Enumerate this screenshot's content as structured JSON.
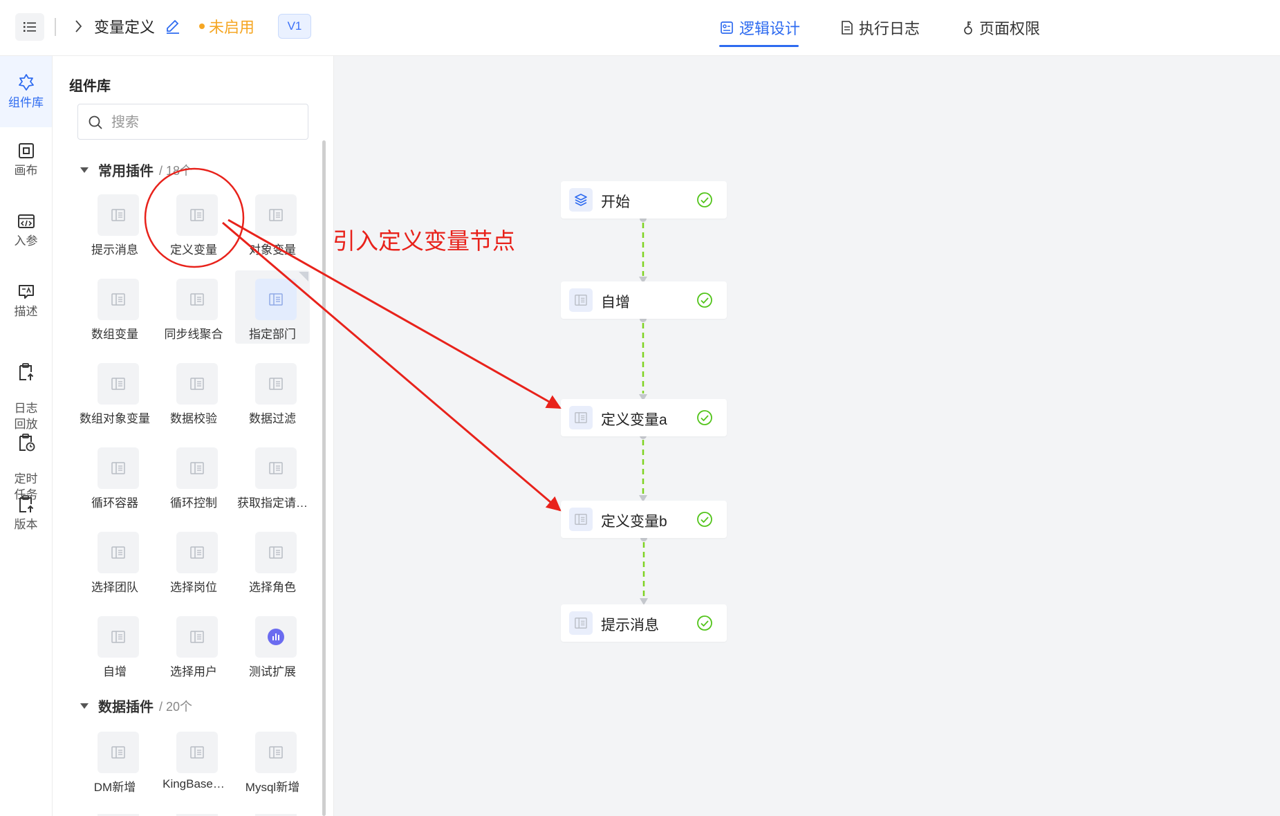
{
  "header": {
    "title": "变量定义",
    "status": "未启用",
    "version": "V1",
    "tabs": [
      {
        "label": "逻辑设计",
        "active": true
      },
      {
        "label": "执行日志",
        "active": false
      },
      {
        "label": "页面权限",
        "active": false
      }
    ]
  },
  "rail": {
    "items": [
      {
        "label": "组件库",
        "icon": "puzzle-icon",
        "active": true
      },
      {
        "label": "画布",
        "icon": "canvas-icon"
      },
      {
        "label": "入参",
        "icon": "code-icon"
      },
      {
        "label": "描述",
        "icon": "describe-icon"
      },
      {
        "label": "日志\n回放",
        "icon": "log-replay-icon"
      },
      {
        "label": "定时\n任务",
        "icon": "timer-task-icon"
      },
      {
        "label": "版本",
        "icon": "version-icon"
      }
    ]
  },
  "panel": {
    "title": "组件库",
    "search_placeholder": "搜索",
    "sections": [
      {
        "name": "常用插件",
        "count": "/ 18个",
        "items": [
          "提示消息",
          "定义变量",
          "对象变量",
          "数组变量",
          "同步线聚合",
          "指定部门",
          "数组对象变量",
          "数据校验",
          "数据过滤",
          "循环容器",
          "循环控制",
          "获取指定请…",
          "选择团队",
          "选择岗位",
          "选择角色",
          "自增",
          "选择用户",
          "测试扩展"
        ]
      },
      {
        "name": "数据插件",
        "count": "/ 20个",
        "items": [
          "DM新增",
          "KingBase…",
          "Mysql新增"
        ]
      }
    ]
  },
  "flow": {
    "nodes": [
      {
        "label": "开始",
        "icon": "layers-icon",
        "status": "success"
      },
      {
        "label": "自增",
        "icon": "component-icon",
        "status": "success"
      },
      {
        "label": "定义变量a",
        "icon": "component-icon",
        "status": "success"
      },
      {
        "label": "定义变量b",
        "icon": "component-icon",
        "status": "success"
      },
      {
        "label": "提示消息",
        "icon": "component-icon",
        "status": "success"
      }
    ]
  },
  "annotation": {
    "text": "引入定义变量节点",
    "color": "#e8221b"
  },
  "colors": {
    "accent": "#2e6bf0",
    "warning": "#f5a623",
    "success": "#52c41a",
    "connector": "#7ed321"
  }
}
